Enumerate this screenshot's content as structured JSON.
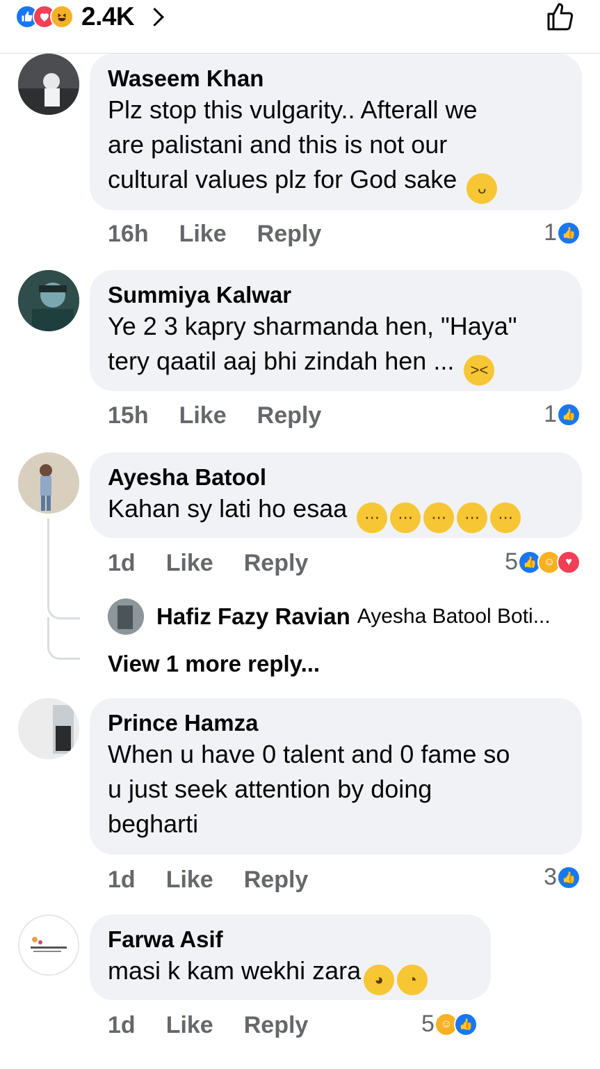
{
  "header": {
    "reaction_count": "2.4K",
    "icons": [
      "like-icon",
      "love-icon",
      "haha-icon",
      "chevron-right-icon",
      "thumbs-up-outline-icon"
    ]
  },
  "comments": [
    {
      "name": "Waseem Khan",
      "text_lines": [
        "Plz stop this vulgarity.. Afterall we",
        "are palistani and this is not our",
        "cultural values plz for God sake"
      ],
      "time": "16h",
      "like": "Like",
      "reply": "Reply",
      "reaction_count": "1"
    },
    {
      "name": "Summiya Kalwar",
      "text_lines": [
        "Ye 2 3 kapry sharmanda hen, \"Haya\"",
        "tery qaatil aaj bhi zindah hen ..."
      ],
      "time": "15h",
      "like": "Like",
      "reply": "Reply",
      "reaction_count": "1"
    },
    {
      "name": "Ayesha Batool",
      "text_lines": [
        "Kahan sy lati ho esaa"
      ],
      "time": "1d",
      "like": "Like",
      "reply": "Reply",
      "reaction_count": "5"
    },
    {
      "name": "Prince Hamza",
      "text_lines": [
        "When u have 0 talent and 0 fame so",
        "u just seek attention by doing",
        "begharti"
      ],
      "time": "1d",
      "like": "Like",
      "reply": "Reply",
      "reaction_count": "3"
    },
    {
      "name": "Farwa Asif",
      "text_lines": [
        "masi k kam wekhi zara"
      ],
      "time": "1d",
      "like": "Like",
      "reply": "Reply",
      "reaction_count": "5"
    }
  ],
  "reply_preview": {
    "name": "Hafiz Fazy Ravian",
    "text": "Ayesha Batool Boti..."
  },
  "view_more": "View 1 more reply..."
}
